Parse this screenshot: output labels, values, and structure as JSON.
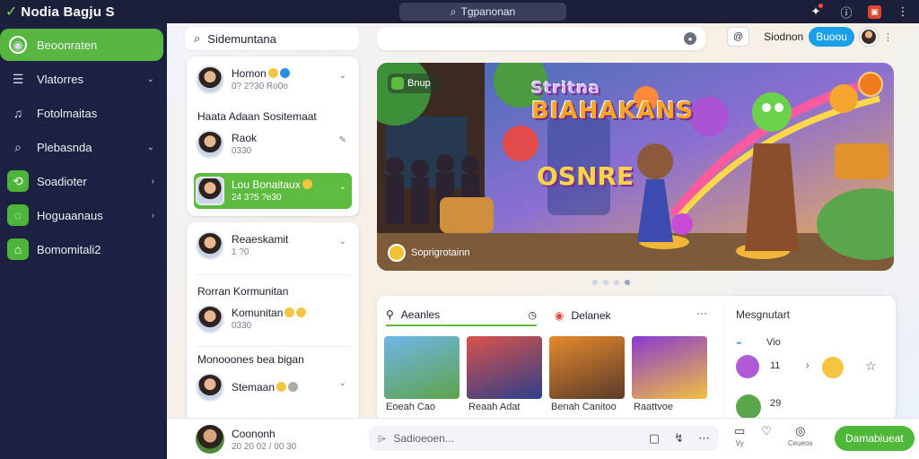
{
  "app": {
    "logo_mark": "✓",
    "title": "Nodia Bagju S"
  },
  "top_search": {
    "label": "Tgpanonan"
  },
  "sidebar": {
    "items": [
      {
        "label": "Beoonraten",
        "chevron": ""
      },
      {
        "label": "Vlatorres",
        "chevron": "⌄"
      },
      {
        "label": "Fotolmaitas",
        "chevron": ""
      },
      {
        "label": "Plebasnda",
        "chevron": "⌄"
      },
      {
        "label": "Soadioter",
        "chevron": "›"
      },
      {
        "label": "Hoguaanaus",
        "chevron": "›"
      },
      {
        "label": "Bomomitali2",
        "chevron": ""
      }
    ]
  },
  "header": {
    "search_value": "Sidemuntana",
    "chip": "@",
    "label": "Siodnon",
    "blue_button": "Buoou"
  },
  "chats_top": {
    "rows": [
      {
        "name": "Homon",
        "sub": "0? 2?30 Ro0o"
      },
      {
        "name": "Raok",
        "sub": "0330"
      },
      {
        "name": "Lou Bonaitaux",
        "sub": "24 3?5 ?e30"
      }
    ],
    "section_title": "Haata Adaan Sositemaat"
  },
  "chats_bottom": {
    "row1": {
      "name": "Reaeskamit",
      "sub": "1 ?0"
    },
    "section2": "Rorran Kormunitan",
    "row2": {
      "name": "Komunitan",
      "sub": "0330"
    },
    "section3": "Monooones bea bigan",
    "row3": {
      "name": "Stemaan",
      "sub": ""
    }
  },
  "banner": {
    "tag": "Bnup",
    "title_line1": "Stritna",
    "title_line2": "BIAHAKANS",
    "title_line3": "OSNRE",
    "caption": "Soprigrotainn"
  },
  "panel": {
    "tab1": "Aeanles",
    "tab2": "Delanek",
    "more": "···",
    "thumbs": [
      {
        "label": "Eoeah Cao"
      },
      {
        "label": "Reaah Adat"
      },
      {
        "label": "Benah Canitoo"
      },
      {
        "label": "Raattvoe"
      }
    ]
  },
  "side_panel": {
    "title": "Mesgnutart",
    "row1_label": "Vio",
    "row1_value": "11",
    "row2_value": "29"
  },
  "bottom": {
    "name": "Coononh",
    "sub": "20 20 02 / 00 30",
    "composer_placeholder": "Sadioeoen...",
    "icon1_label": "Vy",
    "icon3_label": "Ceueos",
    "green_button": "Damabiueat"
  }
}
